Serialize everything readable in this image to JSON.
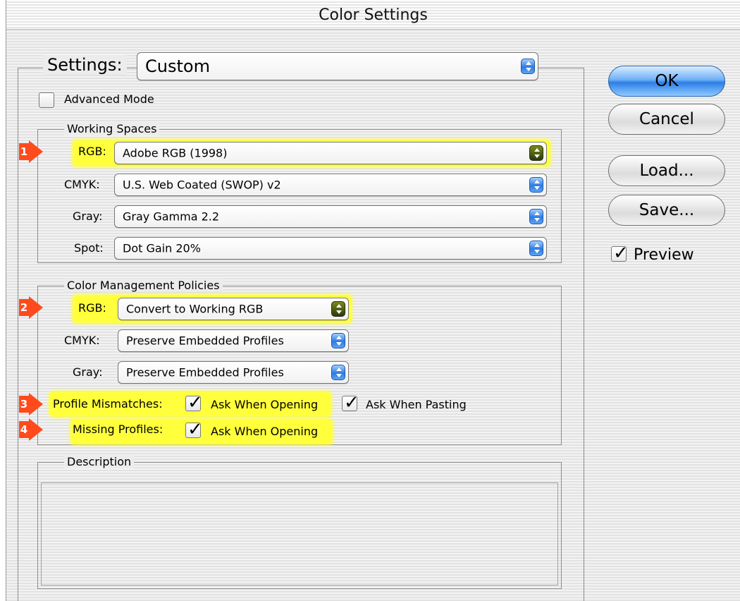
{
  "window": {
    "title": "Color Settings"
  },
  "settings": {
    "label": "Settings:",
    "value": "Custom"
  },
  "advanced_mode": {
    "label": "Advanced Mode",
    "checked": false
  },
  "working_spaces": {
    "title": "Working Spaces",
    "rgb": {
      "label": "RGB:",
      "value": "Adobe RGB (1998)"
    },
    "cmyk": {
      "label": "CMYK:",
      "value": "U.S. Web Coated (SWOP) v2"
    },
    "gray": {
      "label": "Gray:",
      "value": "Gray Gamma 2.2"
    },
    "spot": {
      "label": "Spot:",
      "value": "Dot Gain 20%"
    }
  },
  "policies": {
    "title": "Color Management Policies",
    "rgb": {
      "label": "RGB:",
      "value": "Convert to Working RGB"
    },
    "cmyk": {
      "label": "CMYK:",
      "value": "Preserve Embedded Profiles"
    },
    "gray": {
      "label": "Gray:",
      "value": "Preserve Embedded Profiles"
    },
    "profile_mismatches": {
      "label": "Profile Mismatches:",
      "ask_opening": "Ask When Opening",
      "ask_pasting": "Ask When Pasting"
    },
    "missing_profiles": {
      "label": "Missing Profiles:",
      "ask_opening": "Ask When Opening"
    }
  },
  "description": {
    "title": "Description"
  },
  "buttons": {
    "ok": "OK",
    "cancel": "Cancel",
    "load": "Load...",
    "save": "Save..."
  },
  "preview": {
    "label": "Preview",
    "checked": true
  },
  "annotations": [
    "1",
    "2",
    "3",
    "4"
  ],
  "colors": {
    "highlight": "#ffff3c",
    "badge": "#ff4a1c",
    "accent": "#2b7fe6"
  }
}
